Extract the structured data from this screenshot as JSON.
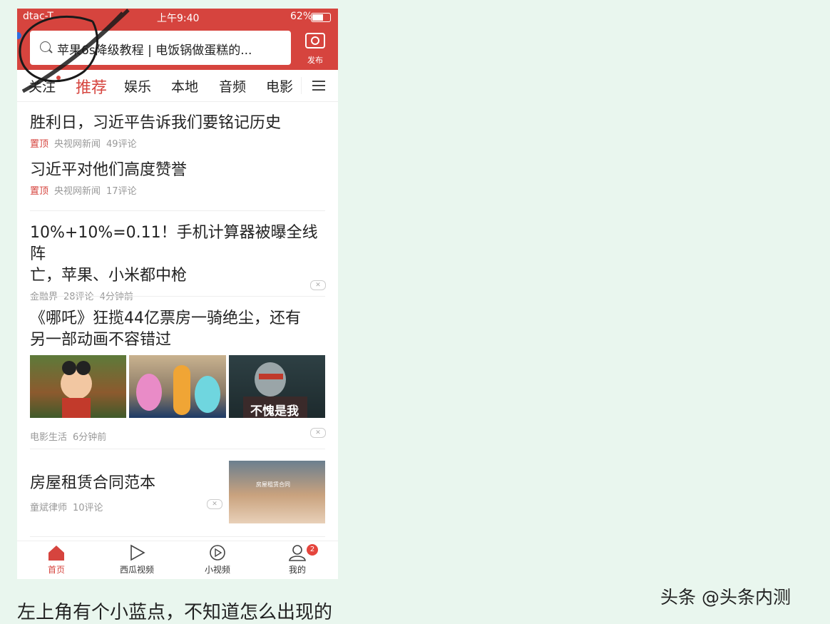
{
  "status": {
    "carrier": "dtac-T",
    "time": "上午9:40",
    "battery": "62%"
  },
  "search": {
    "text": "苹果6s降级教程 | 电饭锅做蛋糕的..."
  },
  "publish_label": "发布",
  "tabs": [
    "关注",
    "推荐",
    "娱乐",
    "本地",
    "音频",
    "电影"
  ],
  "active_tab": "推荐",
  "feed": [
    {
      "title": "胜利日，习近平告诉我们要铭记历史",
      "pinned": "置顶",
      "source": "央视网新闻",
      "comments": "49评论"
    },
    {
      "title": "习近平对他们高度赞誉",
      "pinned": "置顶",
      "source": "央视网新闻",
      "comments": "17评论"
    },
    {
      "title_line1": "10%+10%=0.11！手机计算器被曝全线阵",
      "title_line2": "亡，苹果、小米都中枪",
      "source": "金融界",
      "comments": "28评论",
      "time": "4分钟前"
    },
    {
      "title_line1": "《哪吒》狂揽44亿票房一骑绝尘，还有",
      "title_line2": "另一部动画不容错过",
      "image_caption": "不愧是我",
      "source": "电影生活",
      "time": "6分钟前"
    },
    {
      "title": "房屋租赁合同范本",
      "image_caption": "房屋租赁合同",
      "source": "童斌律师",
      "comments": "10评论"
    }
  ],
  "close_glyph": "✕",
  "bottom_nav": [
    {
      "label": "首页",
      "icon": "home-icon"
    },
    {
      "label": "西瓜视频",
      "icon": "play-icon"
    },
    {
      "label": "小视频",
      "icon": "small-video-icon"
    },
    {
      "label": "我的",
      "icon": "user-icon",
      "badge": "2"
    }
  ],
  "caption": "左上角有个小蓝点，不知道怎么出现的",
  "watermark": "头条 @头条内测",
  "colors": {
    "accent": "#d6443e",
    "background": "#e9f6ee",
    "blue_dot": "#2d6cdf"
  }
}
